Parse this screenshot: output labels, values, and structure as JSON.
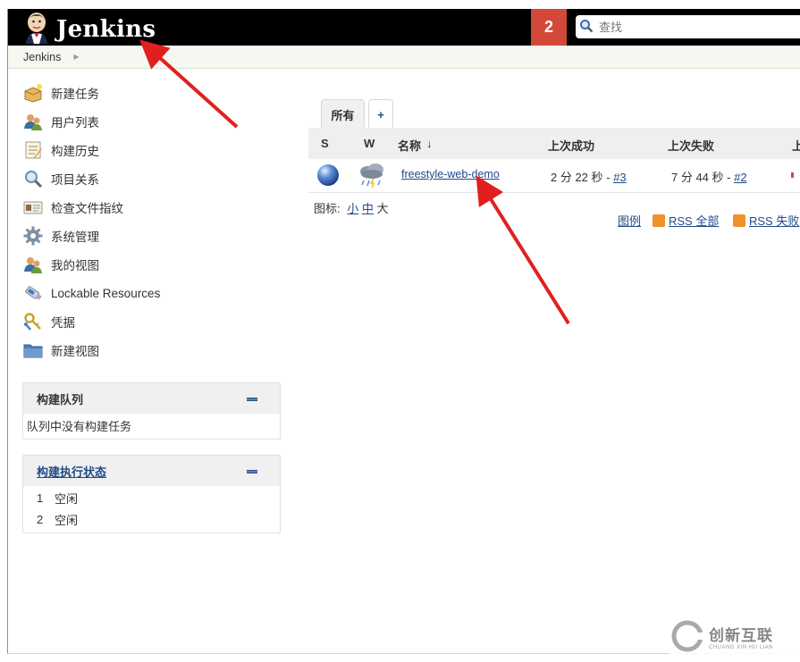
{
  "header": {
    "title": "Jenkins",
    "notification_count": "2",
    "search_placeholder": "查找"
  },
  "breadcrumb": {
    "item": "Jenkins"
  },
  "sidebar": {
    "items": [
      {
        "label": "新建任务",
        "icon": "new-item-icon"
      },
      {
        "label": "用户列表",
        "icon": "users-icon"
      },
      {
        "label": "构建历史",
        "icon": "build-history-icon"
      },
      {
        "label": "项目关系",
        "icon": "search-icon"
      },
      {
        "label": "检查文件指纹",
        "icon": "fingerprint-icon"
      },
      {
        "label": "系统管理",
        "icon": "gear-icon"
      },
      {
        "label": "我的视图",
        "icon": "users-icon"
      },
      {
        "label": "Lockable Resources",
        "icon": "usb-icon"
      },
      {
        "label": "凭据",
        "icon": "keys-icon"
      },
      {
        "label": "新建视图",
        "icon": "folder-icon"
      }
    ]
  },
  "build_queue": {
    "title": "构建队列",
    "empty_text": "队列中没有构建任务"
  },
  "executors": {
    "title": "构建执行状态",
    "rows": [
      {
        "num": "1",
        "status": "空闲"
      },
      {
        "num": "2",
        "status": "空闲"
      }
    ]
  },
  "tabs": [
    {
      "label": "所有"
    },
    {
      "label": "+"
    }
  ],
  "table": {
    "headers": {
      "s": "S",
      "w": "W",
      "name": "名称",
      "sort": "↓",
      "last_success": "上次成功",
      "last_failure": "上次失败",
      "last_duration": "上"
    },
    "rows": [
      {
        "name": "freestyle-web-demo",
        "last_success_time": "2 分 22 秒 - ",
        "last_success_link": "#3",
        "last_failure_time": "7 分 44 秒 - ",
        "last_failure_link": "#2"
      }
    ]
  },
  "icon_sizes": {
    "label": "图标:",
    "small": "小",
    "medium": "中",
    "large": "大"
  },
  "footer_links": {
    "legend": "图例",
    "rss_all": "RSS 全部",
    "rss_failed": "RSS 失败"
  },
  "watermark": {
    "text": "创新互联",
    "sub": "CHUANG XIN HU LIAN"
  },
  "colors": {
    "header_bg": "#000000",
    "badge": "#d24939",
    "link": "#204a87",
    "arrow": "#e02020"
  }
}
